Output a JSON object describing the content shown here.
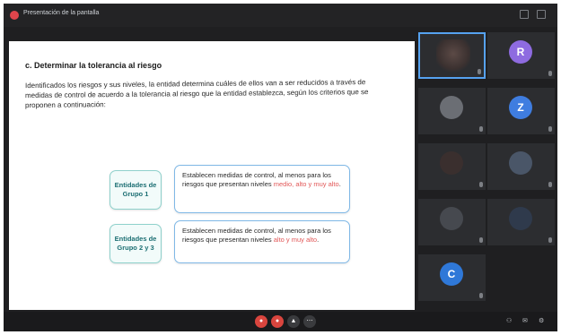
{
  "window": {
    "title": "Presentación de la pantalla"
  },
  "slide": {
    "heading": "c. Determinar la tolerancia al riesgo",
    "body": "Identificados los riesgos y sus niveles, la entidad determina cuáles de ellos van a ser reducidos a través de medidas de control de acuerdo a la tolerancia al riesgo que la entidad establezca, según los criterios que se proponen a continuación:",
    "rows": [
      {
        "left_label": "Entidades de Grupo 1",
        "right_prefix": "Establecen medidas de control, al menos para los riesgos que presentan niveles ",
        "right_red": "medio, alto y muy alto",
        "right_suffix": "."
      },
      {
        "left_label": "Entidades de Grupo 2 y 3",
        "right_prefix": "Establecen medidas de control, al menos para los riesgos que presentan niveles ",
        "right_red": "alto y muy alto",
        "right_suffix": "."
      }
    ]
  },
  "participants": [
    {
      "name": "",
      "type": "video",
      "active": true
    },
    {
      "name": "",
      "type": "avatar",
      "initial": "R",
      "color": "#8e6be0"
    },
    {
      "name": "",
      "type": "avatar",
      "initial": "",
      "color": "#6b6e74"
    },
    {
      "name": "",
      "type": "avatar",
      "initial": "Z",
      "color": "#3f7de0"
    },
    {
      "name": "",
      "type": "avatar",
      "initial": "",
      "color": "#3a2f2e"
    },
    {
      "name": "",
      "type": "avatar",
      "initial": "",
      "color": "#4a5668"
    },
    {
      "name": "",
      "type": "avatar",
      "initial": "",
      "color": "#46494f"
    },
    {
      "name": "",
      "type": "avatar",
      "initial": "",
      "color": "#2f3a4c"
    },
    {
      "name": "",
      "type": "avatar",
      "initial": "C",
      "color": "#2f78d8"
    }
  ],
  "colors": {
    "accent": "#56a2f0",
    "end_call": "#d9453e",
    "highlight_red": "#e25858"
  }
}
